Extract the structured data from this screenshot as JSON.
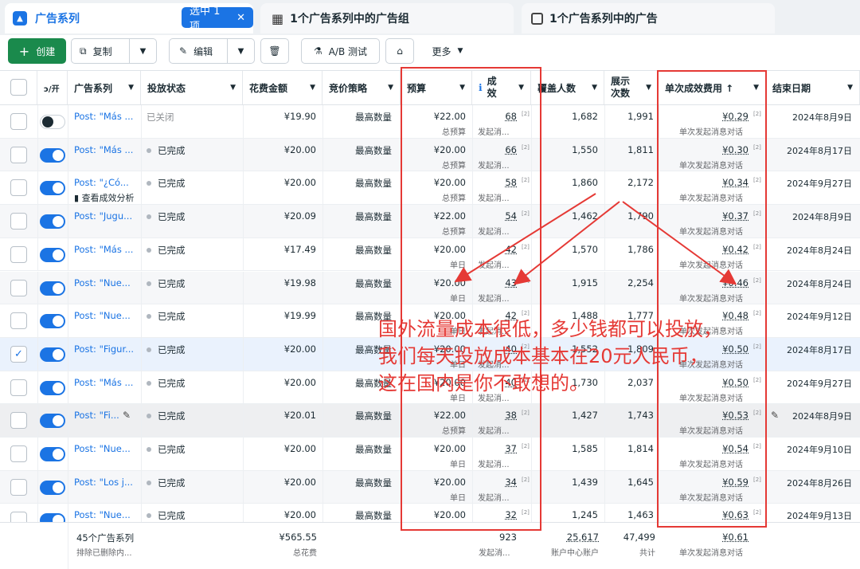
{
  "tabs": {
    "campaigns_label": "广告系列",
    "selected_chip": "选中 1 项",
    "adsets_label": "1个广告系列中的广告组",
    "ads_label": "1个广告系列中的广告"
  },
  "toolbar": {
    "create": "创建",
    "copy": "复制",
    "edit": "编辑",
    "ab_test": "A/B 测试",
    "more": "更多"
  },
  "columns": {
    "toggle": "ɔ/开",
    "campaign": "广告系列",
    "delivery": "投放状态",
    "spend": "花费金额",
    "bid": "竞价策略",
    "budget": "预算",
    "results_l1": "成",
    "results_l2": "效",
    "reach": "覆盖人数",
    "impr_l1": "展示",
    "impr_l2": "次数",
    "cpr": "单次成效费用 ↑",
    "end": "结束日期"
  },
  "rows": [
    {
      "name": "Post: \"Más ...",
      "status": "已关闭",
      "spend": "¥19.90",
      "bid": "最高数量",
      "budget": "¥22.00",
      "budget_type": "总预算",
      "results": "68",
      "results_sub": "发起消...",
      "reach": "1,682",
      "impr": "1,991",
      "cpr": "¥0.29",
      "cpr_sub": "单次发起消息对话",
      "end": "2024年8月9日",
      "on": false
    },
    {
      "name": "Post: \"Más ...",
      "status": "已完成",
      "spend": "¥20.00",
      "bid": "最高数量",
      "budget": "¥20.00",
      "budget_type": "总预算",
      "results": "66",
      "results_sub": "发起消...",
      "reach": "1,550",
      "impr": "1,811",
      "cpr": "¥0.30",
      "cpr_sub": "单次发起消息对话",
      "end": "2024年8月17日",
      "on": true
    },
    {
      "name": "Post: \"¿Có...",
      "sub": "查看成效分析",
      "status": "已完成",
      "spend": "¥20.00",
      "bid": "最高数量",
      "budget": "¥20.00",
      "budget_type": "总预算",
      "results": "58",
      "results_sub": "发起消...",
      "reach": "1,860",
      "impr": "2,172",
      "cpr": "¥0.34",
      "cpr_sub": "单次发起消息对话",
      "end": "2024年9月27日",
      "on": true
    },
    {
      "name": "Post: \"Jugu...",
      "status": "已完成",
      "spend": "¥20.09",
      "bid": "最高数量",
      "budget": "¥22.00",
      "budget_type": "总预算",
      "results": "54",
      "results_sub": "发起消...",
      "reach": "1,462",
      "impr": "1,790",
      "cpr": "¥0.37",
      "cpr_sub": "单次发起消息对话",
      "end": "2024年8月9日",
      "on": true
    },
    {
      "name": "Post: \"Más ...",
      "status": "已完成",
      "spend": "¥17.49",
      "bid": "最高数量",
      "budget": "¥20.00",
      "budget_type": "单日",
      "results": "42",
      "results_sub": "发起消...",
      "reach": "1,570",
      "impr": "1,786",
      "cpr": "¥0.42",
      "cpr_sub": "单次发起消息对话",
      "end": "2024年8月24日",
      "on": true
    },
    {
      "name": "Post: \"Nue...",
      "status": "已完成",
      "spend": "¥19.98",
      "bid": "最高数量",
      "budget": "¥20.00",
      "budget_type": "单日",
      "results": "43",
      "results_sub": "发起消...",
      "reach": "1,915",
      "impr": "2,254",
      "cpr": "¥0.46",
      "cpr_sub": "单次发起消息对话",
      "end": "2024年8月24日",
      "on": true
    },
    {
      "name": "Post: \"Nue...",
      "status": "已完成",
      "spend": "¥19.99",
      "bid": "最高数量",
      "budget": "¥20.00",
      "budget_type": "单日",
      "results": "42",
      "results_sub": "发起消...",
      "reach": "1,488",
      "impr": "1,777",
      "cpr": "¥0.48",
      "cpr_sub": "单次发起消息对话",
      "end": "2024年9月12日",
      "on": true
    },
    {
      "name": "Post: \"Figur...",
      "status": "已完成",
      "spend": "¥20.00",
      "bid": "最高数量",
      "budget": "¥20.00",
      "budget_type": "单日",
      "results": "40",
      "results_sub": "发起消...",
      "reach": "1,552",
      "impr": "1,809",
      "cpr": "¥0.50",
      "cpr_sub": "单次发起消息对话",
      "end": "2024年8月17日",
      "on": true,
      "selected": true
    },
    {
      "name": "Post: \"Más ...",
      "status": "已完成",
      "spend": "¥20.00",
      "bid": "最高数量",
      "budget": "¥20.00",
      "budget_type": "单日",
      "results": "40",
      "results_sub": "发起消...",
      "reach": "1,730",
      "impr": "2,037",
      "cpr": "¥0.50",
      "cpr_sub": "单次发起消息对话",
      "end": "2024年9月27日",
      "on": true
    },
    {
      "name": "Post: \"Fi...",
      "status": "已完成",
      "spend": "¥20.01",
      "bid": "最高数量",
      "budget": "¥22.00",
      "budget_type": "总预算",
      "results": "38",
      "results_sub": "发起消...",
      "reach": "1,427",
      "impr": "1,743",
      "cpr": "¥0.53",
      "cpr_sub": "单次发起消息对话",
      "end": "2024年8月9日",
      "on": true,
      "hover": true
    },
    {
      "name": "Post: \"Nue...",
      "status": "已完成",
      "spend": "¥20.00",
      "bid": "最高数量",
      "budget": "¥20.00",
      "budget_type": "单日",
      "results": "37",
      "results_sub": "发起消...",
      "reach": "1,585",
      "impr": "1,814",
      "cpr": "¥0.54",
      "cpr_sub": "单次发起消息对话",
      "end": "2024年9月10日",
      "on": true
    },
    {
      "name": "Post: \"Los j...",
      "status": "已完成",
      "spend": "¥20.00",
      "bid": "最高数量",
      "budget": "¥20.00",
      "budget_type": "单日",
      "results": "34",
      "results_sub": "发起消...",
      "reach": "1,439",
      "impr": "1,645",
      "cpr": "¥0.59",
      "cpr_sub": "单次发起消息对话",
      "end": "2024年8月26日",
      "on": true
    },
    {
      "name": "Post: \"Nue...",
      "status": "已完成",
      "spend": "¥20.00",
      "bid": "最高数量",
      "budget": "¥20.00",
      "budget_type": "单日",
      "results": "32",
      "results_sub": "发起消...",
      "reach": "1,245",
      "impr": "1,463",
      "cpr": "¥0.63",
      "cpr_sub": "单次发起消息对话",
      "end": "2024年9月13日",
      "on": true
    }
  ],
  "footer": {
    "count": "45个广告系列",
    "count_sub": "排除已删除内...",
    "spend": "¥565.55",
    "spend_sub": "总花费",
    "results": "923",
    "results_sub": "发起消...",
    "reach": "25,617",
    "reach_sub": "账户中心账户",
    "impr": "47,499",
    "impr_sub": "共计",
    "cpr": "¥0.61",
    "cpr_sub": "单次发起消息对话"
  },
  "annotation": {
    "line1": "国外流量成本很低，多少钱都可以投放，",
    "line2": "我们每天投放成本基本在20元人民币，",
    "line3": "这在国内是你不敢想的。"
  },
  "colors": {
    "accent": "#1b74e4",
    "create": "#1a8a4c",
    "annotation": "#e53935"
  }
}
